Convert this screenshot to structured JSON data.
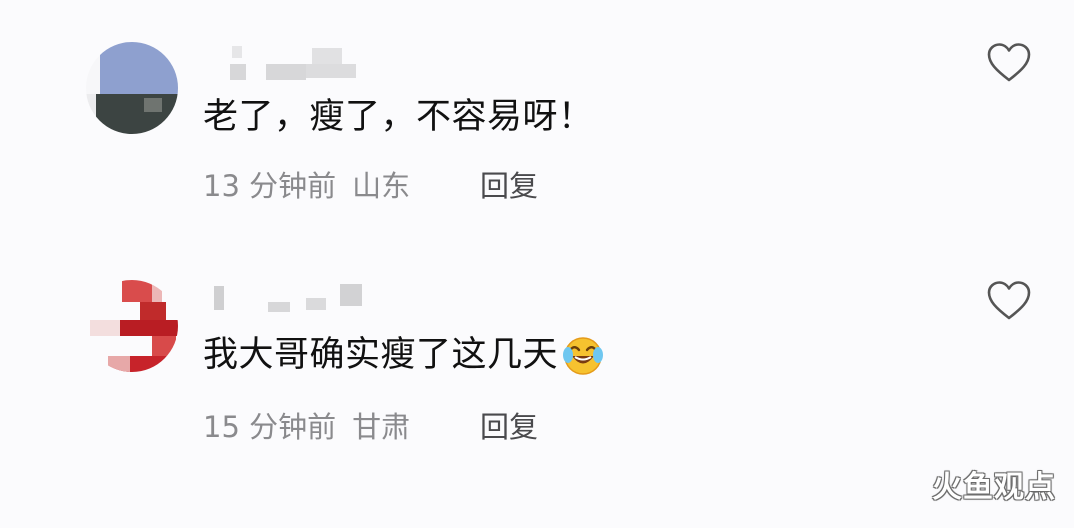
{
  "comments": [
    {
      "content": "老了，瘦了，不容易呀！",
      "time": "13 分钟前",
      "location": "山东",
      "reply_label": "回复",
      "liked": false
    },
    {
      "content": "我大哥确实瘦了这几天",
      "emoji": "face-with-tears-of-joy",
      "time": "15 分钟前",
      "location": "甘肃",
      "reply_label": "回复",
      "liked": false
    }
  ],
  "watermark": "火鱼观点",
  "colors": {
    "background": "#fbfbfd",
    "text": "#111111",
    "meta": "#8a8a8d",
    "reply": "#4a4a4d",
    "heart": "#555555"
  }
}
